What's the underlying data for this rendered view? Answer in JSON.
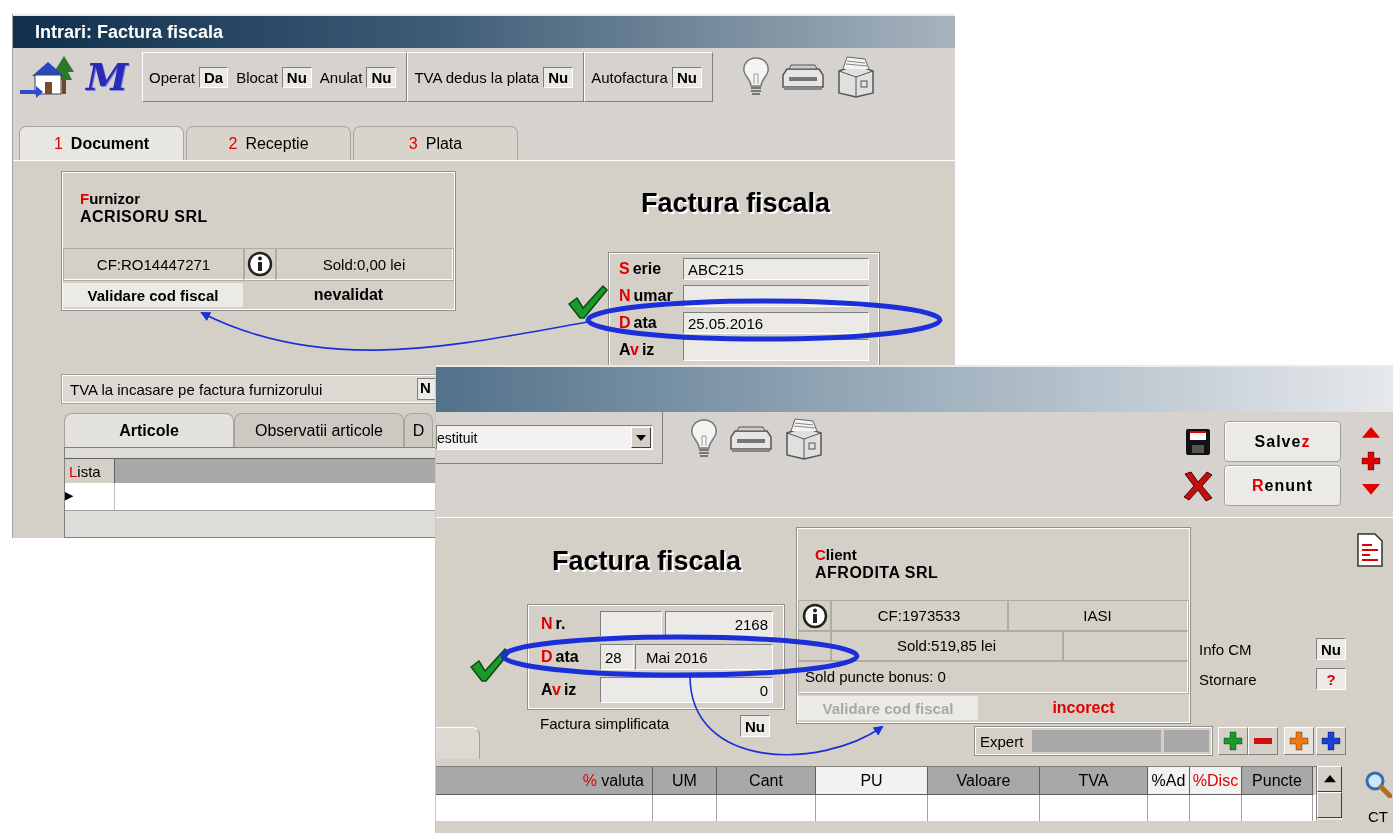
{
  "back_window": {
    "title": "Intrari: Factura fiscala",
    "logo": "M",
    "flag_groups": [
      [
        {
          "label": "Operat",
          "value": "Da"
        },
        {
          "label": "Blocat",
          "value": "Nu"
        },
        {
          "label": "Anulat",
          "value": "Nu"
        }
      ],
      [
        {
          "label": "TVA dedus la plata",
          "value": "Nu"
        }
      ],
      [
        {
          "label": "Autofactura",
          "value": "Nu"
        }
      ]
    ],
    "tabs": [
      {
        "number": "1",
        "label": "Document",
        "selected": true
      },
      {
        "number": "2",
        "label": "Receptie",
        "selected": false
      },
      {
        "number": "3",
        "label": "Plata",
        "selected": false
      }
    ],
    "supplier": {
      "label": [
        {
          "text": "F",
          "accent": true
        },
        {
          "text": "urnizor",
          "accent": false
        }
      ],
      "name": "ACRISORU SRL",
      "tax_id": "CF:RO14447271",
      "balance": "Sold:0,00 lei",
      "validate_button": "Validare cod fiscal",
      "validate_disabled": false,
      "validation_status": "nevalidat",
      "error": false
    },
    "heading": "Factura fiscala",
    "fields": [
      {
        "label": [
          {
            "text": "S",
            "accent": true
          },
          {
            "text": "erie",
            "accent": false
          }
        ],
        "value": "ABC215"
      },
      {
        "label": [
          {
            "text": "N",
            "accent": true
          },
          {
            "text": "umar",
            "accent": false
          }
        ]
      },
      {
        "label": [
          {
            "text": "D",
            "accent": true
          },
          {
            "text": "ata",
            "accent": false
          }
        ],
        "value": "25.05.2016"
      },
      {
        "label": [
          {
            "text": "A",
            "accent": false
          },
          {
            "text": "v",
            "accent": true
          },
          {
            "text": "iz",
            "accent": false
          }
        ]
      }
    ],
    "vat_on_collection": {
      "label": "TVA la incasare pe factura furnizorului",
      "value": "N"
    },
    "item_tabs": [
      {
        "label": "Articole",
        "selected": true
      },
      {
        "label": "Observatii articole",
        "selected": false
      },
      {
        "label": "D",
        "selected": false
      }
    ],
    "grid_columns": [
      {
        "label": [
          {
            "text": "L",
            "accent": true
          },
          {
            "text": "ista",
            "accent": false
          }
        ]
      }
    ]
  },
  "front_window": {
    "combo_value": "estituit",
    "buttons": [
      {
        "kind": "save",
        "label": [
          {
            "text": "Salve",
            "accent": false
          },
          {
            "text": "z",
            "accent": true
          }
        ]
      },
      {
        "kind": "cancel",
        "label": [
          {
            "text": "R",
            "accent": true
          },
          {
            "text": "enunt",
            "accent": false
          }
        ]
      }
    ],
    "heading": "Factura fiscala",
    "fields": [
      {
        "kind": "number",
        "label": [
          {
            "text": "N",
            "accent": true
          },
          {
            "text": "r.",
            "accent": false
          }
        ],
        "value": "2168"
      },
      {
        "kind": "date",
        "label": [
          {
            "text": "D",
            "accent": true
          },
          {
            "text": "ata",
            "accent": false
          }
        ],
        "day": "28",
        "value": "Mai 2016"
      },
      {
        "kind": "plain",
        "label": [
          {
            "text": "A",
            "accent": false
          },
          {
            "text": "v",
            "accent": true
          },
          {
            "text": "iz",
            "accent": false
          }
        ],
        "value": "0"
      }
    ],
    "simplified": {
      "label": "Factura simplificata",
      "value": "Nu"
    },
    "client": {
      "label": [
        {
          "text": "C",
          "accent": true
        },
        {
          "text": "lient",
          "accent": false
        }
      ],
      "name": "AFRODITA SRL",
      "tax_id": "CF:1973533",
      "city": "IASI",
      "balance": "Sold:519,85 lei",
      "bonus": "Sold puncte bonus:  0",
      "validate_button": "Validare cod fiscal",
      "validate_disabled": true,
      "validation_status": "incorect",
      "error": true
    },
    "info": [
      {
        "label": "Info CM",
        "value": "Nu",
        "kind": "plain"
      },
      {
        "label": "Stornare",
        "value": "?",
        "kind": "warning"
      }
    ],
    "expert_label": "Expert",
    "table_columns": [
      {
        "kind": "grey",
        "label": [
          {
            "text": "%",
            "accent": true
          },
          {
            "text": " valuta",
            "accent": false
          }
        ]
      },
      {
        "kind": "grey",
        "label": [
          {
            "text": "UM",
            "accent": false
          }
        ]
      },
      {
        "kind": "grey",
        "label": [
          {
            "text": "Cant",
            "accent": false
          }
        ]
      },
      {
        "kind": "white",
        "label": [
          {
            "text": "PU",
            "accent": false
          }
        ]
      },
      {
        "kind": "grey",
        "label": [
          {
            "text": "Valoare",
            "accent": false
          }
        ]
      },
      {
        "kind": "grey",
        "label": [
          {
            "text": "TVA",
            "accent": false
          }
        ]
      },
      {
        "kind": "white",
        "label": [
          {
            "text": "%Ad",
            "accent": false
          }
        ]
      },
      {
        "kind": "white",
        "label": [
          {
            "text": "%Disc",
            "accent": true
          }
        ]
      },
      {
        "kind": "grey",
        "label": [
          {
            "text": "Puncte",
            "accent": false
          }
        ]
      }
    ],
    "side_label": "CT"
  }
}
